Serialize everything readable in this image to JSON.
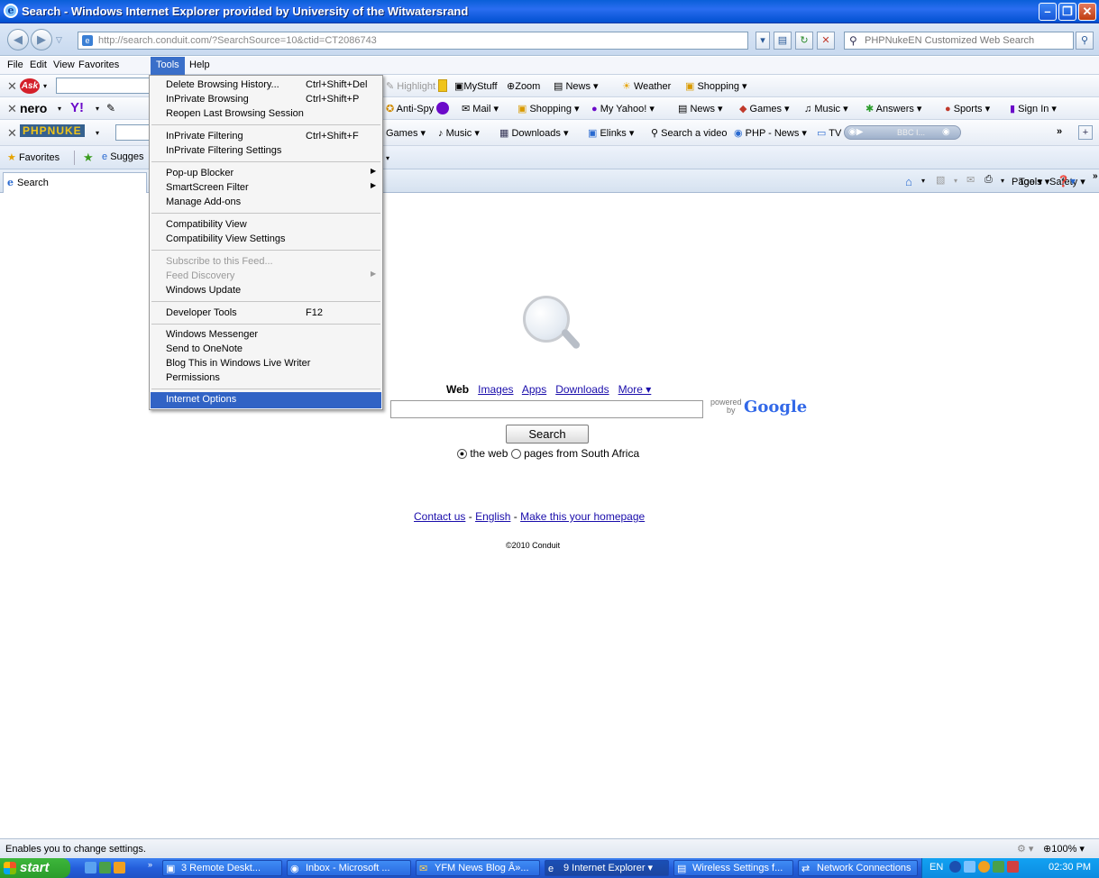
{
  "window": {
    "title": "Search - Windows Internet Explorer provided by University of the Witwatersrand"
  },
  "address": {
    "url": "http://search.conduit.com/?SearchSource=10&ctid=CT2086743",
    "search_placeholder": "PHPNukeEN Customized Web Search"
  },
  "menu": {
    "file": "File",
    "edit": "Edit",
    "view": "View",
    "favorites": "Favorites",
    "tools": "Tools",
    "help": "Help"
  },
  "toolbar1": {
    "highlight": "Highlight",
    "mystuff": "MyStuff",
    "zoom": "Zoom",
    "news": "News",
    "weather": "Weather",
    "shopping": "Shopping"
  },
  "toolbar2": {
    "nero": "nero",
    "antispy": "Anti-Spy",
    "mail": "Mail",
    "shopping": "Shopping",
    "myyahoo": "My Yahoo!",
    "news": "News",
    "games": "Games",
    "music": "Music",
    "answers": "Answers",
    "sports": "Sports",
    "signin": "Sign In"
  },
  "toolbar3": {
    "logo": "PHPNUKE",
    "games": "Games",
    "music": "Music",
    "downloads": "Downloads",
    "elinks": "Elinks",
    "searchvideo": "Search a video",
    "phpnews": "PHP - News",
    "tv": "TV",
    "radio": "BBC I..."
  },
  "favbar": {
    "favorites": "Favorites",
    "suggested": "Sugges"
  },
  "tab": {
    "title": "Search"
  },
  "cmdbar": {
    "page": "Page",
    "safety": "Safety",
    "tools": "Tools"
  },
  "tools_menu": [
    {
      "label": "Delete Browsing History...",
      "shortcut": "Ctrl+Shift+Del"
    },
    {
      "label": "InPrivate Browsing",
      "shortcut": "Ctrl+Shift+P"
    },
    {
      "label": "Reopen Last Browsing Session",
      "shortcut": ""
    },
    {
      "label": "InPrivate Filtering",
      "shortcut": "Ctrl+Shift+F"
    },
    {
      "label": "InPrivate Filtering Settings",
      "shortcut": ""
    },
    {
      "label": "Pop-up Blocker",
      "shortcut": ""
    },
    {
      "label": "SmartScreen Filter",
      "shortcut": ""
    },
    {
      "label": "Manage Add-ons",
      "shortcut": ""
    },
    {
      "label": "Compatibility View",
      "shortcut": ""
    },
    {
      "label": "Compatibility View Settings",
      "shortcut": ""
    },
    {
      "label": "Subscribe to this Feed...",
      "shortcut": ""
    },
    {
      "label": "Feed Discovery",
      "shortcut": ""
    },
    {
      "label": "Windows Update",
      "shortcut": ""
    },
    {
      "label": "Developer Tools",
      "shortcut": "F12"
    },
    {
      "label": "Windows Messenger",
      "shortcut": ""
    },
    {
      "label": "Send to OneNote",
      "shortcut": ""
    },
    {
      "label": "Blog This in Windows Live Writer",
      "shortcut": ""
    },
    {
      "label": "Permissions",
      "shortcut": ""
    },
    {
      "label": "Internet Options",
      "shortcut": ""
    }
  ],
  "search": {
    "web": "Web",
    "images": "Images",
    "apps": "Apps",
    "downloads": "Downloads",
    "more": "More ▾",
    "powered": "powered",
    "by": "by",
    "google": "Google",
    "button": "Search",
    "radio_web": "the web",
    "radio_local": "pages from South Africa"
  },
  "footer": {
    "contact": "Contact us",
    "english": "English",
    "homepage": "Make this your homepage",
    "sep": "-",
    "copyright": "©2010 Conduit"
  },
  "status": {
    "text": "Enables you to change settings.",
    "zoom": "100%"
  },
  "taskbar": {
    "start": "start",
    "tasks": [
      "3 Remote Deskt...",
      "Inbox - Microsoft ...",
      "YFM News Blog Â»...",
      "9 Internet Explorer",
      "Wireless Settings f...",
      "Network Connections"
    ],
    "lang": "EN",
    "time": "02:30 PM"
  }
}
